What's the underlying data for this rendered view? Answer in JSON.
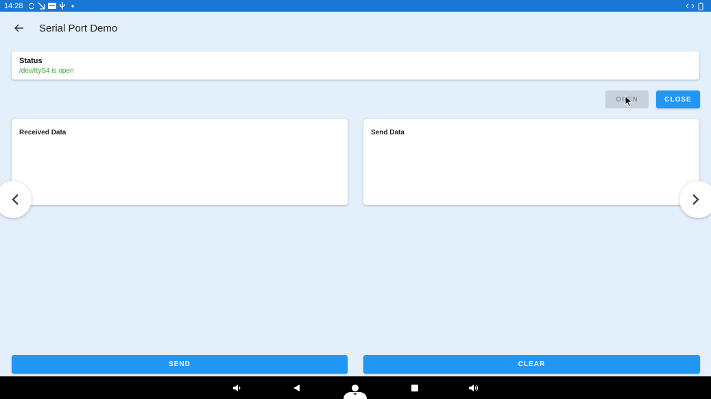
{
  "status_bar": {
    "time": "14:28",
    "icons": [
      "sync-icon",
      "signal-off-icon",
      "keyboard-icon",
      "usb-icon",
      "dot-icon"
    ],
    "right_icons": [
      "code-arrows-icon",
      "battery-icon"
    ]
  },
  "app_bar": {
    "title": "Serial Port Demo",
    "back_icon": "arrow-left-icon"
  },
  "status_card": {
    "label": "Status",
    "value": "/dev/ttyS4 is open",
    "value_color": "#3aa63c"
  },
  "port_buttons": {
    "open_label": "OPEN",
    "close_label": "CLOSE"
  },
  "received": {
    "title": "Received Data",
    "content": ""
  },
  "send": {
    "title": "Send Data",
    "content": ""
  },
  "actions": {
    "send_label": "SEND",
    "clear_label": "CLEAR"
  },
  "navigation": {
    "prev_icon": "chevron-left-icon",
    "next_icon": "chevron-right-icon"
  },
  "nav_bar": {
    "buttons": [
      "volume-down-icon",
      "back-triangle-icon",
      "home-circle-icon",
      "recents-square-icon",
      "volume-up-icon"
    ]
  },
  "colors": {
    "accent": "#2196f3",
    "status_bar": "#1976d2",
    "background": "#e3effb",
    "disabled": "#c8d1db"
  }
}
